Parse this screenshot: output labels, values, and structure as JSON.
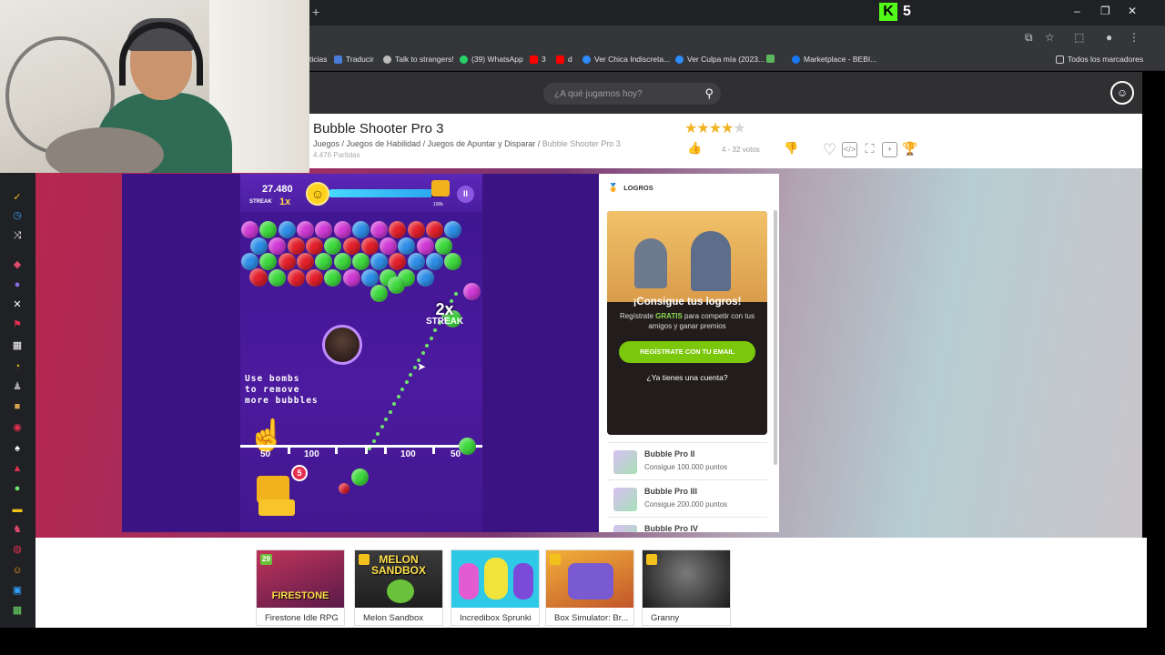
{
  "browser": {
    "new_tab": "+",
    "kick_count": "5",
    "window_controls": [
      "–",
      "❐",
      "✕"
    ],
    "bookmarks": [
      {
        "label": "ticias",
        "color": "#888888"
      },
      {
        "label": "Traducir",
        "color": "#4a7bd8"
      },
      {
        "label": "Talk to strangers!",
        "color": "#bbbbbb"
      },
      {
        "label": "(39) WhatsApp",
        "color": "#25d366"
      },
      {
        "label": "3",
        "color": "#ff0000"
      },
      {
        "label": "d",
        "color": "#ff0000"
      },
      {
        "label": "Ver Chica Indiscreta...",
        "color": "#2d8cff"
      },
      {
        "label": "Ver Culpa mía (2023...",
        "color": "#2d8cff"
      },
      {
        "label": "",
        "color": "#5cb85c"
      },
      {
        "label": "Marketplace - BEBI...",
        "color": "#1877f2"
      }
    ],
    "all_bookmarks": "Todos los marcadores"
  },
  "site": {
    "search_placeholder": "¿A qué jugamos hoy?"
  },
  "game_info": {
    "title": "Bubble Shooter Pro 3",
    "breadcrumb": [
      "Juegos",
      "Juegos de Habilidad",
      "Juegos de Apuntar y Disparar"
    ],
    "breadcrumb_current": "Bubble Shooter Pro 3",
    "plays": "4.476 Partidas",
    "rating": 4,
    "rating_max": 5,
    "votes": "4 - 32 votos"
  },
  "game": {
    "score": "27.480",
    "streak_label": "STREAK",
    "multiplier": "1x",
    "progress": 0.88,
    "progress_max_label": "100k",
    "pause": "II",
    "streak_big": "2x",
    "streak_big_label": "STREAK",
    "tip": [
      "Use bombs",
      "to remove",
      "more bubbles"
    ],
    "points": [
      "50",
      "100",
      "100",
      "50"
    ],
    "bomb_count": "5",
    "colors": {
      "green": "#3ed93e",
      "red": "#e3202c",
      "blue": "#2f8fe8",
      "magenta": "#d03ad6",
      "purple": "#6a3bd6"
    }
  },
  "achievements": {
    "header": "LOGROS",
    "promo_title": "¡Consigue tus logros!",
    "promo_text_1": "Regístrate",
    "promo_text_highlight": "GRATIS",
    "promo_text_2": "para competir con tus amigos y ganar premios",
    "register_button": "REGÍSTRATE CON TU EMAIL",
    "login_link": "¿Ya tienes una cuenta?",
    "items": [
      {
        "name": "Bubble Pro II",
        "desc": "Consigue 100.000 puntos"
      },
      {
        "name": "Bubble Pro III",
        "desc": "Consigue 200.000 puntos"
      },
      {
        "name": "Bubble Pro IV",
        "desc": ""
      }
    ]
  },
  "related_games": [
    {
      "label": "Firestone Idle RPG",
      "tag": "29",
      "img_text": "FIRESTONE",
      "bg": "#8a2a4a"
    },
    {
      "label": "Melon Sandbox",
      "tag": "",
      "img_text": "MELON SANDBOX",
      "bg": "#2b2b2b"
    },
    {
      "label": "Incredibox Sprunki",
      "tag": "",
      "img_text": "",
      "bg": "#2fc9e8"
    },
    {
      "label": "Box Simulator: Br...",
      "tag": "",
      "img_text": "",
      "bg": "#e08a2a"
    },
    {
      "label": "Granny",
      "tag": "",
      "img_text": "",
      "bg": "#3a3a3a"
    }
  ]
}
